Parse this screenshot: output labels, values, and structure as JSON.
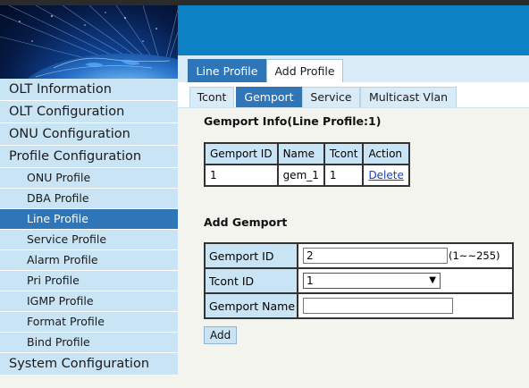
{
  "sidebar": {
    "items": [
      {
        "label": "OLT Information"
      },
      {
        "label": "OLT Configuration"
      },
      {
        "label": "ONU Configuration"
      },
      {
        "label": "Profile Configuration"
      }
    ],
    "sub_items": [
      {
        "label": "ONU Profile"
      },
      {
        "label": "DBA Profile"
      },
      {
        "label": "Line Profile",
        "active": true
      },
      {
        "label": "Service Profile"
      },
      {
        "label": "Alarm Profile"
      },
      {
        "label": "Pri Profile"
      },
      {
        "label": "IGMP Profile"
      },
      {
        "label": "Format Profile"
      },
      {
        "label": "Bind Profile"
      }
    ],
    "last_item": {
      "label": "System Configuration"
    }
  },
  "tabs_primary": [
    {
      "label": "Line Profile",
      "active": true
    },
    {
      "label": "Add Profile"
    }
  ],
  "tabs_secondary": [
    {
      "label": "Tcont"
    },
    {
      "label": "Gemport",
      "active": true
    },
    {
      "label": "Service"
    },
    {
      "label": "Multicast Vlan"
    }
  ],
  "gemport_info": {
    "title": "Gemport Info(Line Profile:1)",
    "columns": [
      "Gemport ID",
      "Name",
      "Tcont",
      "Action"
    ],
    "rows": [
      {
        "gemport_id": "1",
        "name": "gem_1",
        "tcont": "1",
        "action": "Delete"
      }
    ]
  },
  "add_gemport": {
    "title": "Add Gemport",
    "gemport_id_label": "Gemport ID",
    "gemport_id_value": "2",
    "gemport_id_hint": "(1~~255)",
    "tcont_id_label": "Tcont ID",
    "tcont_id_value": "1",
    "gemport_name_label": "Gemport Name",
    "gemport_name_value": "",
    "add_button": "Add"
  },
  "colors": {
    "accent": "#2f76b8",
    "banner": "#0c82c4",
    "nav_bg": "#c9e4f5",
    "link": "#1d3fc4"
  }
}
